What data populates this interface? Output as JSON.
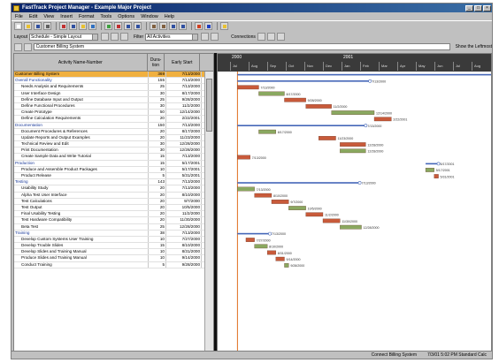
{
  "window": {
    "title": "FastTrack Project Manager - Example Major Project"
  },
  "menu": [
    "File",
    "Edit",
    "View",
    "Insert",
    "Format",
    "Tools",
    "Options",
    "Window",
    "Help"
  ],
  "toolbar2": {
    "layout_label": "Layout",
    "layout_value": "Schedule - Simple Layout",
    "filter_label": "Filter",
    "filter_value": "All Activities",
    "connections_label": "Connections"
  },
  "entry_bar": {
    "value": "Customer Billing System",
    "help": "Show the Leftmost"
  },
  "columns": {
    "name": "Activity Name-Number",
    "dur": "Dura-tion",
    "date": "Early Start"
  },
  "rows": [
    {
      "name": "Customer Billing System",
      "dur": "369",
      "date": "7/13/2000",
      "kind": "top"
    },
    {
      "name": "Overall Functionality",
      "dur": "155",
      "date": "7/13/2000",
      "kind": "sum"
    },
    {
      "name": "Needs Analysis and Requirements",
      "dur": "25",
      "date": "7/13/2000",
      "kind": "sub"
    },
    {
      "name": "User Interface Design",
      "dur": "30",
      "date": "8/17/2000",
      "kind": "sub"
    },
    {
      "name": "Define Database Input and Output",
      "dur": "25",
      "date": "9/28/2000",
      "kind": "sub"
    },
    {
      "name": "Define Functional Procedures",
      "dur": "30",
      "date": "11/2/2000",
      "kind": "sub"
    },
    {
      "name": "Create Prototype",
      "dur": "50",
      "date": "12/14/2000",
      "kind": "sub"
    },
    {
      "name": "Define Calculation Requirements",
      "dur": "20",
      "date": "2/22/2001",
      "kind": "sub"
    },
    {
      "name": "Documentation",
      "dur": "150",
      "date": "7/13/2000",
      "kind": "sum"
    },
    {
      "name": "Document Procedures & References",
      "dur": "20",
      "date": "8/17/2000",
      "kind": "sub"
    },
    {
      "name": "Update Reports and Output Examples",
      "dur": "20",
      "date": "11/23/2000",
      "kind": "sub"
    },
    {
      "name": "Technical Review and Edit",
      "dur": "30",
      "date": "12/28/2000",
      "kind": "sub"
    },
    {
      "name": "Print Documentation",
      "dur": "30",
      "date": "12/28/2000",
      "kind": "sub"
    },
    {
      "name": "Create Sample Data and Write Tutorial",
      "dur": "15",
      "date": "7/13/2000",
      "kind": "sub"
    },
    {
      "name": "Production",
      "dur": "15",
      "date": "5/17/2001",
      "kind": "sum"
    },
    {
      "name": "Produce and Assemble Product Packages",
      "dur": "10",
      "date": "5/17/2001",
      "kind": "sub"
    },
    {
      "name": "Product Release",
      "dur": "5",
      "date": "5/31/2001",
      "kind": "sub"
    },
    {
      "name": "Testing",
      "dur": "143",
      "date": "7/13/2000",
      "kind": "sum"
    },
    {
      "name": "Usability Study",
      "dur": "20",
      "date": "7/13/2000",
      "kind": "sub"
    },
    {
      "name": "Alpha Test User Interface",
      "dur": "20",
      "date": "8/10/2000",
      "kind": "sub"
    },
    {
      "name": "Test Calculations",
      "dur": "20",
      "date": "9/7/2000",
      "kind": "sub"
    },
    {
      "name": "Test Output",
      "dur": "20",
      "date": "10/5/2000",
      "kind": "sub"
    },
    {
      "name": "Final Usability Testing",
      "dur": "20",
      "date": "11/2/2000",
      "kind": "sub"
    },
    {
      "name": "Test Hardware Compatibility",
      "dur": "20",
      "date": "11/30/2000",
      "kind": "sub"
    },
    {
      "name": "Beta Test",
      "dur": "25",
      "date": "12/28/2000",
      "kind": "sub"
    },
    {
      "name": "Training",
      "dur": "38",
      "date": "7/13/2000",
      "kind": "sum"
    },
    {
      "name": "Develop Custom Systems User Training",
      "dur": "10",
      "date": "7/27/2000",
      "kind": "sub"
    },
    {
      "name": "Develop Trouble Slides",
      "dur": "15",
      "date": "8/10/2000",
      "kind": "sub"
    },
    {
      "name": "Develop Slides and Training Manual",
      "dur": "10",
      "date": "8/31/2000",
      "kind": "sub"
    },
    {
      "name": "Produce Slides and Training Manual",
      "dur": "10",
      "date": "9/14/2000",
      "kind": "sub"
    },
    {
      "name": "Conduct Training",
      "dur": "5",
      "date": "9/28/2000",
      "kind": "sub"
    }
  ],
  "gantt": {
    "years": [
      "2000",
      "2001"
    ],
    "months": [
      "Jul",
      "Aug",
      "Sep",
      "Oct",
      "Nov",
      "Dec",
      "Jan",
      "Feb",
      "Mar",
      "Apr",
      "May",
      "Jun",
      "Jul",
      "Aug"
    ],
    "colors": {
      "task": "#c85a3a",
      "alt": "#8aa860",
      "summary": "#4466b8",
      "today": "#e07020"
    }
  },
  "status": {
    "left": "Connect Billing System",
    "right": "7/3/01 5:02 PM  Standard Calc"
  }
}
